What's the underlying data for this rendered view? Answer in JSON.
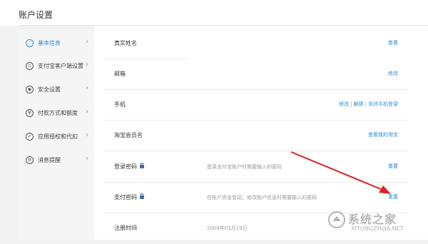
{
  "page": {
    "title": "账户设置"
  },
  "sidebar": {
    "items": [
      {
        "label": "基本信息",
        "active": true,
        "icon": "user-icon"
      },
      {
        "label": "支付宝客户端设置",
        "active": false,
        "icon": "phone-client-icon"
      },
      {
        "label": "安全设置",
        "active": false,
        "icon": "lock-icon"
      },
      {
        "label": "付款方式和额度",
        "active": false,
        "icon": "yen-icon"
      },
      {
        "label": "应用授权和代扣",
        "active": false,
        "icon": "check-icon"
      },
      {
        "label": "消息提醒",
        "active": false,
        "icon": "message-icon"
      }
    ]
  },
  "rows": [
    {
      "label": "真实姓名",
      "desc": "",
      "actions": [
        "查看"
      ]
    },
    {
      "label": "邮箱",
      "desc": "",
      "actions": [
        "修改"
      ]
    },
    {
      "label": "手机",
      "desc": "",
      "actions": [
        "修改",
        "解绑",
        "关闭手机登录"
      ]
    },
    {
      "label": "淘宝会员名",
      "desc": "",
      "actions": [
        "查看我的淘宝"
      ]
    },
    {
      "label": "登录密码",
      "desc": "登录支付宝账户时需要输入的密码",
      "actions": [
        "重置"
      ],
      "lock": true
    },
    {
      "label": "支付密码",
      "desc": "在账户资金变动，修改账户信息时需要输入的密码",
      "actions": [
        "重置"
      ],
      "lock": true
    },
    {
      "label": "注册时间",
      "desc": "2009年03月19日",
      "actions": []
    }
  ],
  "colors": {
    "accent": "#2b8cd6",
    "arrow": "#e02020"
  },
  "watermark": {
    "text": "系统之家",
    "url": "XITONGZHIJIA.NET"
  }
}
